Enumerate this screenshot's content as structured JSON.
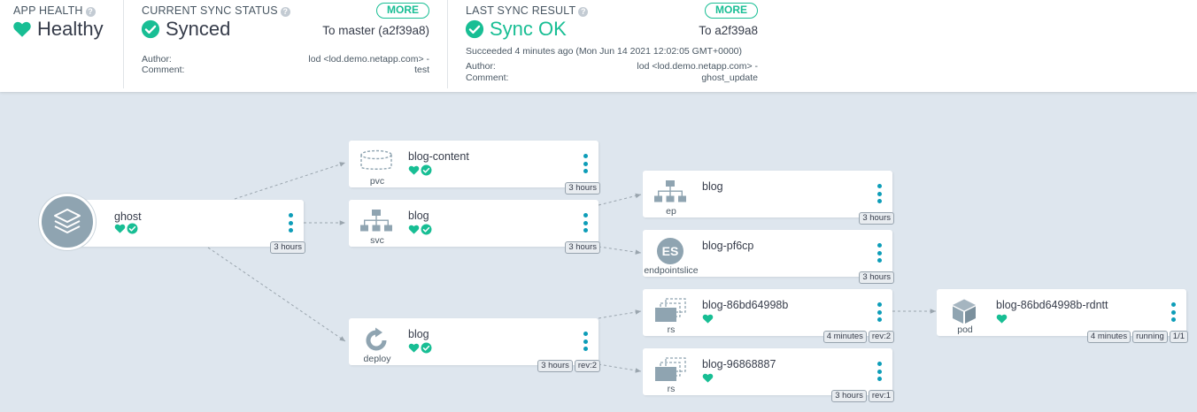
{
  "status": {
    "health": {
      "title": "APP HEALTH",
      "value": "Healthy",
      "help": "?"
    },
    "sync": {
      "title": "CURRENT SYNC STATUS",
      "help": "?",
      "value": "Synced",
      "more": "MORE",
      "target": "To master (a2f39a8)",
      "author_label": "Author:",
      "author": "lod <lod.demo.netapp.com> -",
      "comment_label": "Comment:",
      "comment": "test"
    },
    "result": {
      "title": "LAST SYNC RESULT",
      "help": "?",
      "value": "Sync OK",
      "more": "MORE",
      "target": "To a2f39a8",
      "succeeded": "Succeeded 4 minutes ago (Mon Jun 14 2021 12:02:05 GMT+0000)",
      "author_label": "Author:",
      "author": "lod <lod.demo.netapp.com> -",
      "comment_label": "Comment:",
      "comment": "ghost_update"
    }
  },
  "colors": {
    "healthy": "#18be94",
    "accent": "#0d9db8",
    "icon_gray": "#8fa4b1",
    "canvas": "#dee6ee"
  },
  "nodes": {
    "ghost": {
      "name": "ghost",
      "icon": "layers-icon",
      "tags": [
        "3 hours"
      ]
    },
    "pvc": {
      "name": "blog-content",
      "kind": "pvc",
      "icon": "disk-icon",
      "tags": [
        "3 hours"
      ]
    },
    "svc": {
      "name": "blog",
      "kind": "svc",
      "icon": "network-icon",
      "tags": [
        "3 hours"
      ]
    },
    "deploy": {
      "name": "blog",
      "kind": "deploy",
      "icon": "refresh-icon",
      "tags": [
        "3 hours",
        "rev:2"
      ]
    },
    "ep": {
      "name": "blog",
      "kind": "ep",
      "icon": "network-icon",
      "tags": [
        "3 hours"
      ]
    },
    "es": {
      "name": "blog-pf6cp",
      "kind": "endpointslice",
      "badge": "ES",
      "tags": [
        "3 hours"
      ]
    },
    "rs1": {
      "name": "blog-86bd64998b",
      "kind": "rs",
      "icon": "replicaset-icon",
      "tags": [
        "4 minutes",
        "rev:2"
      ]
    },
    "rs2": {
      "name": "blog-96868887",
      "kind": "rs",
      "icon": "replicaset-icon",
      "tags": [
        "3 hours",
        "rev:1"
      ]
    },
    "pod": {
      "name": "blog-86bd64998b-rdntt",
      "kind": "pod",
      "icon": "cube-icon",
      "tags": [
        "4 minutes",
        "running",
        "1/1"
      ]
    }
  }
}
